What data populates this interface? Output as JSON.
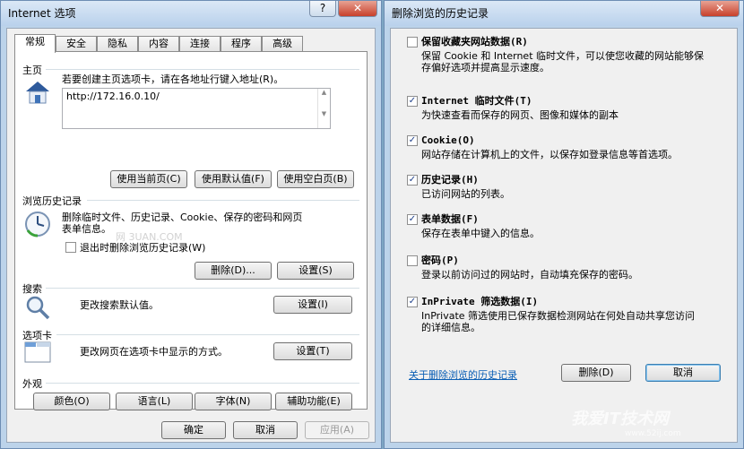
{
  "internet_options": {
    "title": "Internet 选项",
    "help_glyph": "?",
    "close_glyph": "✕",
    "tabs": [
      "常规",
      "安全",
      "隐私",
      "内容",
      "连接",
      "程序",
      "高级"
    ],
    "home": {
      "section": "主页",
      "desc": "若要创建主页选项卡，请在各地址行键入地址(R)。",
      "address": "http://172.16.0.10/",
      "btn_current": "使用当前页(C)",
      "btn_default": "使用默认值(F)",
      "btn_blank": "使用空白页(B)"
    },
    "history": {
      "section": "浏览历史记录",
      "desc_line1": "删除临时文件、历史记录、Cookie、保存的密码和网页",
      "desc_line2": "表单信息。",
      "checkbox": "退出时删除浏览历史记录(W)",
      "btn_delete": "删除(D)...",
      "btn_settings": "设置(S)"
    },
    "search": {
      "section": "搜索",
      "desc": "更改搜索默认值。",
      "btn_settings": "设置(I)"
    },
    "tabs_section": {
      "section": "选项卡",
      "desc": "更改网页在选项卡中显示的方式。",
      "btn_settings": "设置(T)"
    },
    "appearance": {
      "section": "外观",
      "btn_colors": "颜色(O)",
      "btn_languages": "语言(L)",
      "btn_fonts": "字体(N)",
      "btn_accessibility": "辅助功能(E)"
    },
    "footer": {
      "ok": "确定",
      "cancel": "取消",
      "apply": "应用(A)"
    },
    "watermark": "网 3UAN.COM"
  },
  "delete_history": {
    "title": "删除浏览的历史记录",
    "close_glyph": "✕",
    "check_glyph": "✓",
    "items": [
      {
        "title": "保留收藏夹网站数据(R)",
        "desc1": "保留 Cookie 和 Internet 临时文件，可以使您收藏的网站能够保",
        "desc2": "存偏好选项并提高显示速度。",
        "checked": false
      },
      {
        "title": "Internet 临时文件(T)",
        "desc1": "为快速查看而保存的网页、图像和媒体的副本",
        "desc2": "",
        "checked": true
      },
      {
        "title": "Cookie(O)",
        "desc1": "网站存储在计算机上的文件，以保存如登录信息等首选项。",
        "desc2": "",
        "checked": true
      },
      {
        "title": "历史记录(H)",
        "desc1": "已访问网站的列表。",
        "desc2": "",
        "checked": true
      },
      {
        "title": "表单数据(F)",
        "desc1": "保存在表单中键入的信息。",
        "desc2": "",
        "checked": true
      },
      {
        "title": "密码(P)",
        "desc1": "登录以前访问过的网站时，自动填充保存的密码。",
        "desc2": "",
        "checked": false
      },
      {
        "title": "InPrivate 筛选数据(I)",
        "desc1": "InPrivate 筛选使用已保存数据检测网站在何处自动共享您访问",
        "desc2": "的详细信息。",
        "checked": true
      }
    ],
    "link": "关于删除浏览的历史记录",
    "btn_delete": "删除(D)",
    "btn_cancel": "取消"
  },
  "site_watermark": {
    "text": "我爱IT技术网",
    "url": "www.52ij.com"
  }
}
